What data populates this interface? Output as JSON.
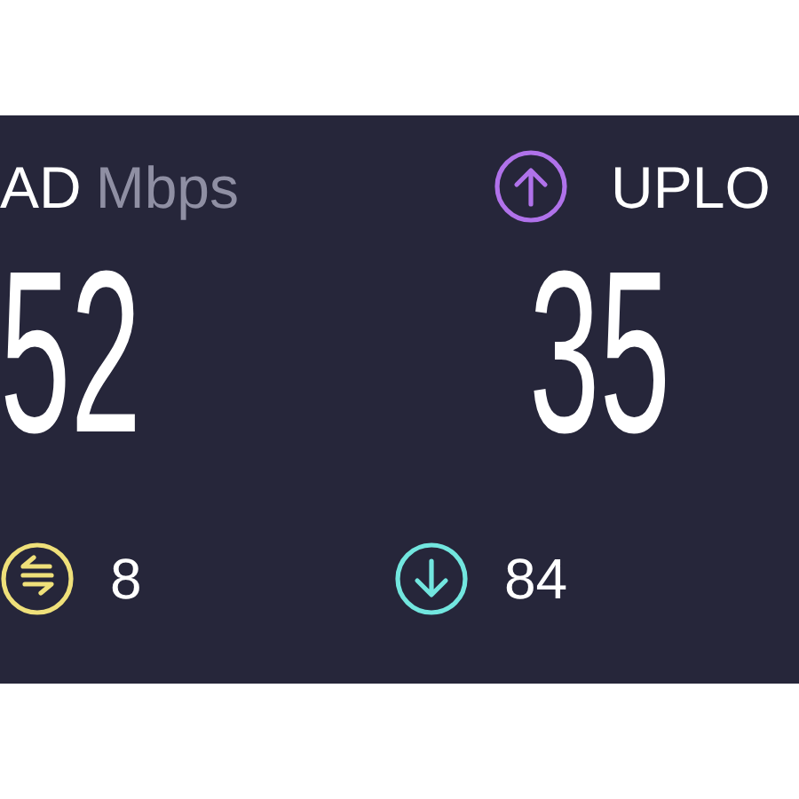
{
  "results": [
    {
      "label": "AD",
      "unit": "Mbps",
      "value": "52"
    },
    {
      "kind": "upload",
      "color": "#b072ea",
      "label": "UPLO",
      "value": "35"
    }
  ],
  "stats": [
    {
      "kind": "jitter",
      "color": "#efe07a",
      "value": "8"
    },
    {
      "kind": "download",
      "color": "#72e6df",
      "value": "84"
    }
  ]
}
